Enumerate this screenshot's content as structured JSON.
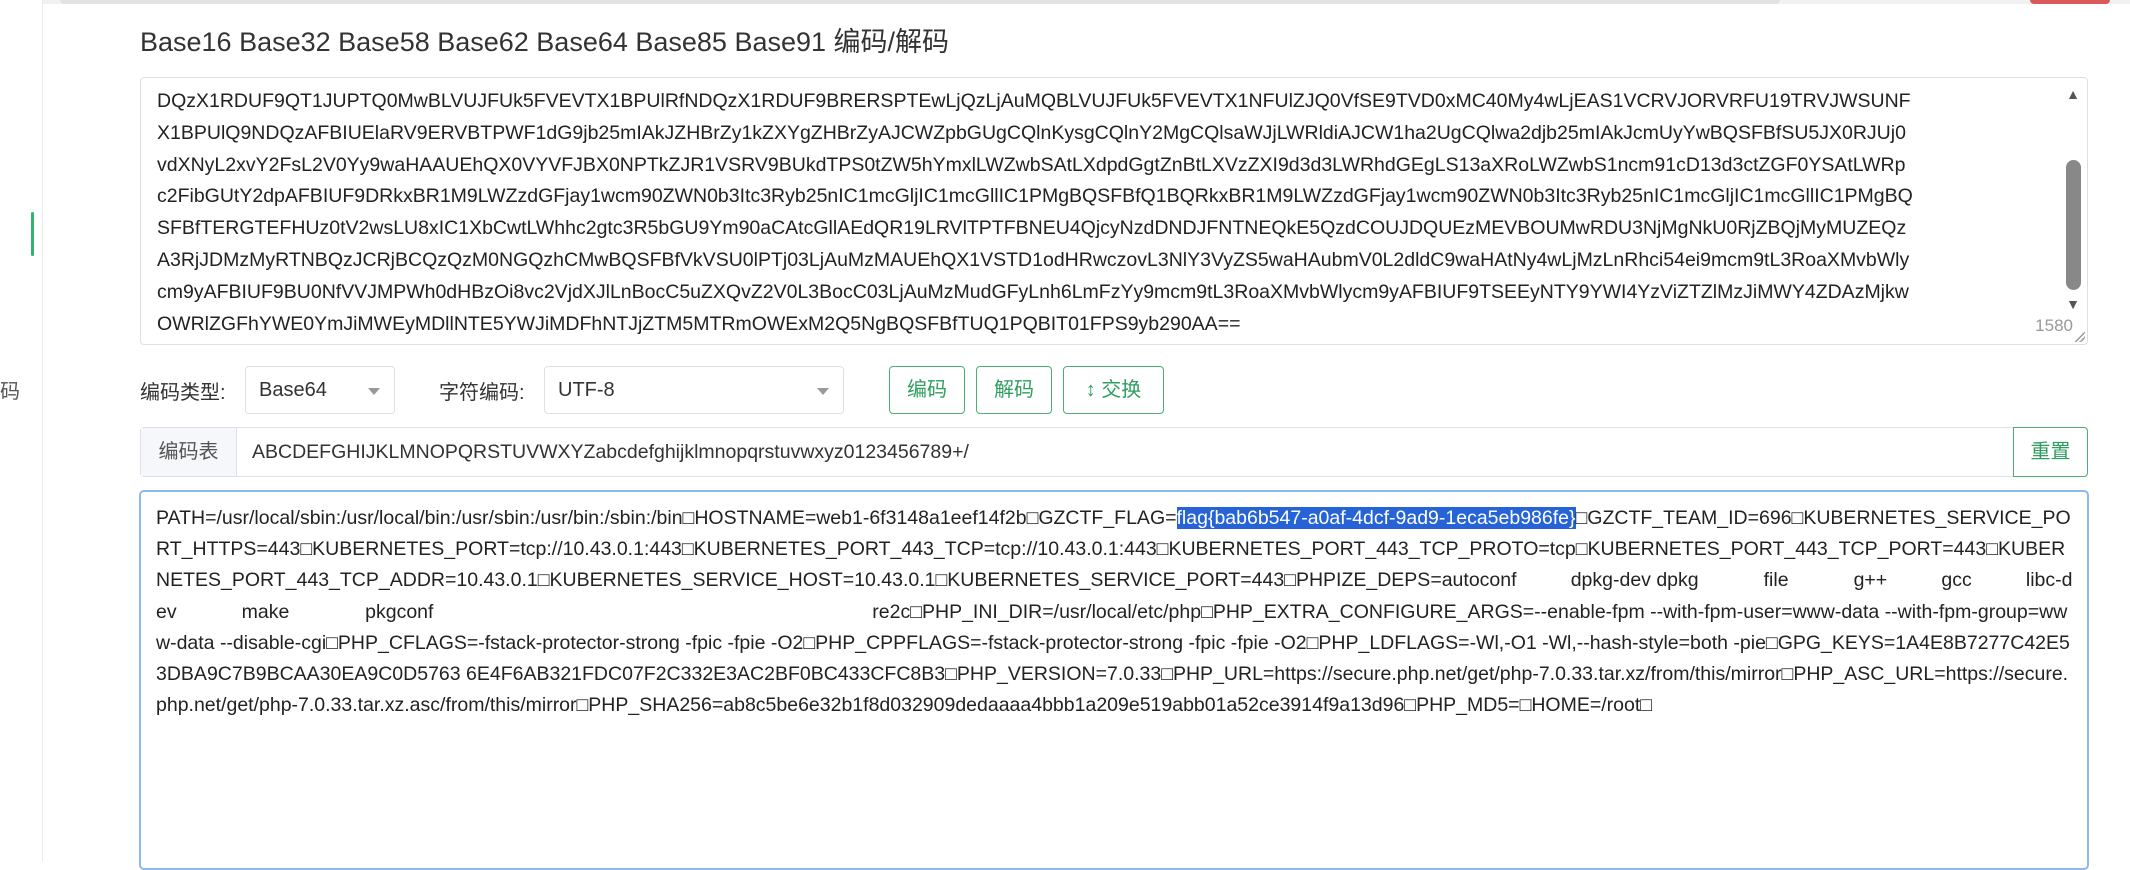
{
  "page": {
    "title": "Base16 Base32 Base58 Base62 Base64 Base85 Base91 编码/解码",
    "sidebar_fragment": "码"
  },
  "input": {
    "lines": [
      "DQzX1RDUF9QT1JUPTQ0MwBLVUJFUk5FVEVTX1BPUlRfNDQzX1RDUF9BRERSPTEwLjQzLjAuMQBLVUJFUk5FVEVTX1NFUlZJQ0VfSE9TVD0xMC40My4wLjEAS1VCRVJORVRFU19TRVJWSUNF",
      "X1BPUlQ9NDQzAFBIUElaRV9ERVBTPWF1dG9jb25mIAkJZHBrZy1kZXYgZHBrZyAJCWZpbGUgCQlnKysgCQlnY2MgCQlsaWJjLWRldiAJCW1ha2UgCQlwa2djb25mIAkJcmUyYwBQSFBfSU5JX0RJUj0",
      "vdXNyL2xvY2FsL2V0Yy9waHAAUEhQX0VYVFJBX0NPTkZJR1VSRV9BUkdTPS0tZW5hYmxlLWZwbSAtLXdpdGgtZnBtLXVzZXI9d3d3LWRhdGEgLS13aXRoLWZwbS1ncm91cD13d3ctZGF0YSAtLWRp",
      "c2FibGUtY2dpAFBIUF9DRkxBR1M9LWZzdGFjay1wcm90ZWN0b3Itc3Ryb25nIC1mcGljIC1mcGllIC1PMgBQSFBfQ1BQRkxBR1M9LWZzdGFjay1wcm90ZWN0b3Itc3Ryb25nIC1mcGljIC1mcGllIC1PMgBQ",
      "SFBfTERGTEFHUz0tV2wsLU8xIC1XbCwtLWhhc2gtc3R5bGU9Ym90aCAtcGllAEdQR19LRVlTPTFBNEU4QjcyNzdDNDJFNTNEQkE5QzdCOUJDQUEzMEVBOUMwRDU3NjMgNkU0RjZBQjMyMUZEQz",
      "A3RjJDMzMyRTNBQzJCRjBCQzQzM0NGQzhCMwBQSFBfVkVSU0lPTj03LjAuMzMAUEhQX1VSTD1odHRwczovL3NlY3VyZS5waHAubmV0L2dldC9waHAtNy4wLjMzLnRhci54ei9mcm9tL3RoaXMvbWly",
      "cm9yAFBIUF9BU0NfVVJMPWh0dHBzOi8vc2VjdXJlLnBocC5uZXQvZ2V0L3BocC03LjAuMzMudGFyLnh6LmFzYy9mcm9tL3RoaXMvbWlycm9yAFBIUF9TSEEyNTY9YWI4YzViZTZlMzJiMWY4ZDAzMjkw",
      "OWRlZGFhYWE0YmJiMWEyMDllNTE5YWJiMDFhNTJjZTM5MTRmOWExM2Q5NgBQSFBfTUQ1PQBIT01FPS9yb290AA=="
    ],
    "char_count": "1580"
  },
  "controls": {
    "encode_type_label": "编码类型:",
    "encode_type_value": "Base64",
    "charset_label": "字符编码:",
    "charset_value": "UTF-8",
    "encode_button": "编码",
    "decode_button": "解码",
    "swap_button": "↕ 交换"
  },
  "code_table": {
    "label": "编码表",
    "value": "ABCDEFGHIJKLMNOPQRSTUVWXYZabcdefghijklmnopqrstuvwxyz0123456789+/",
    "reset_button": "重置"
  },
  "output": {
    "seg1": "PATH=/usr/local/sbin:/usr/local/bin:/usr/sbin:/usr/bin:/sbin:/bin□HOSTNAME=web1-6f3148a1eef14f2b□GZCTF_FLAG=",
    "flag": "flag{bab6b547-a0af-4dcf-9ad9-1eca5eb986fe}",
    "seg2": "□GZCTF_TEAM_ID=696□KUBERNETES_SERVICE_PORT_HTTPS=443□KUBERNETES_PORT=tcp://10.43.0.1:443□KUBERNETES_PORT_443_TCP=tcp://10.43.0.1:443□KUBERNETES_PORT_443_TCP_PROTO=tcp□KUBERNETES_PORT_443_TCP_PORT=443□KUBERNETES_PORT_443_TCP_ADDR=10.43.0.1□KUBERNETES_SERVICE_HOST=10.43.0.1□KUBERNETES_SERVICE_PORT=443□PHPIZE_DEPS=autoconf          dpkg-dev dpkg            file            g++          gcc          libc-dev            make              pkgconf                                                                                 re2c□PHP_INI_DIR=/usr/local/etc/php□PHP_EXTRA_CONFIGURE_ARGS=--enable-fpm --with-fpm-user=www-data --with-fpm-group=www-data --disable-cgi□PHP_CFLAGS=-fstack-protector-strong -fpic -fpie -O2□PHP_CPPFLAGS=-fstack-protector-strong -fpic -fpie -O2□PHP_LDFLAGS=-Wl,-O1 -Wl,--hash-style=both -pie□GPG_KEYS=1A4E8B7277C42E53DBA9C7B9BCAA30EA9C0D5763 6E4F6AB321FDC07F2C332E3AC2BF0BC433CFC8B3□PHP_VERSION=7.0.33□PHP_URL=https://secure.php.net/get/php-7.0.33.tar.xz/from/this/mirror□PHP_ASC_URL=https://secure.php.net/get/php-7.0.33.tar.xz.asc/from/this/mirror□PHP_SHA256=ab8c5be6e32b1f8d032909dedaaaa4bbb1a209e519abb01a52ce3914f9a13d96□PHP_MD5=□HOME=/root□"
  },
  "colors": {
    "accent": "#2f9e5f",
    "focus_border": "#8fb8ec",
    "selection": "#2563d6"
  }
}
